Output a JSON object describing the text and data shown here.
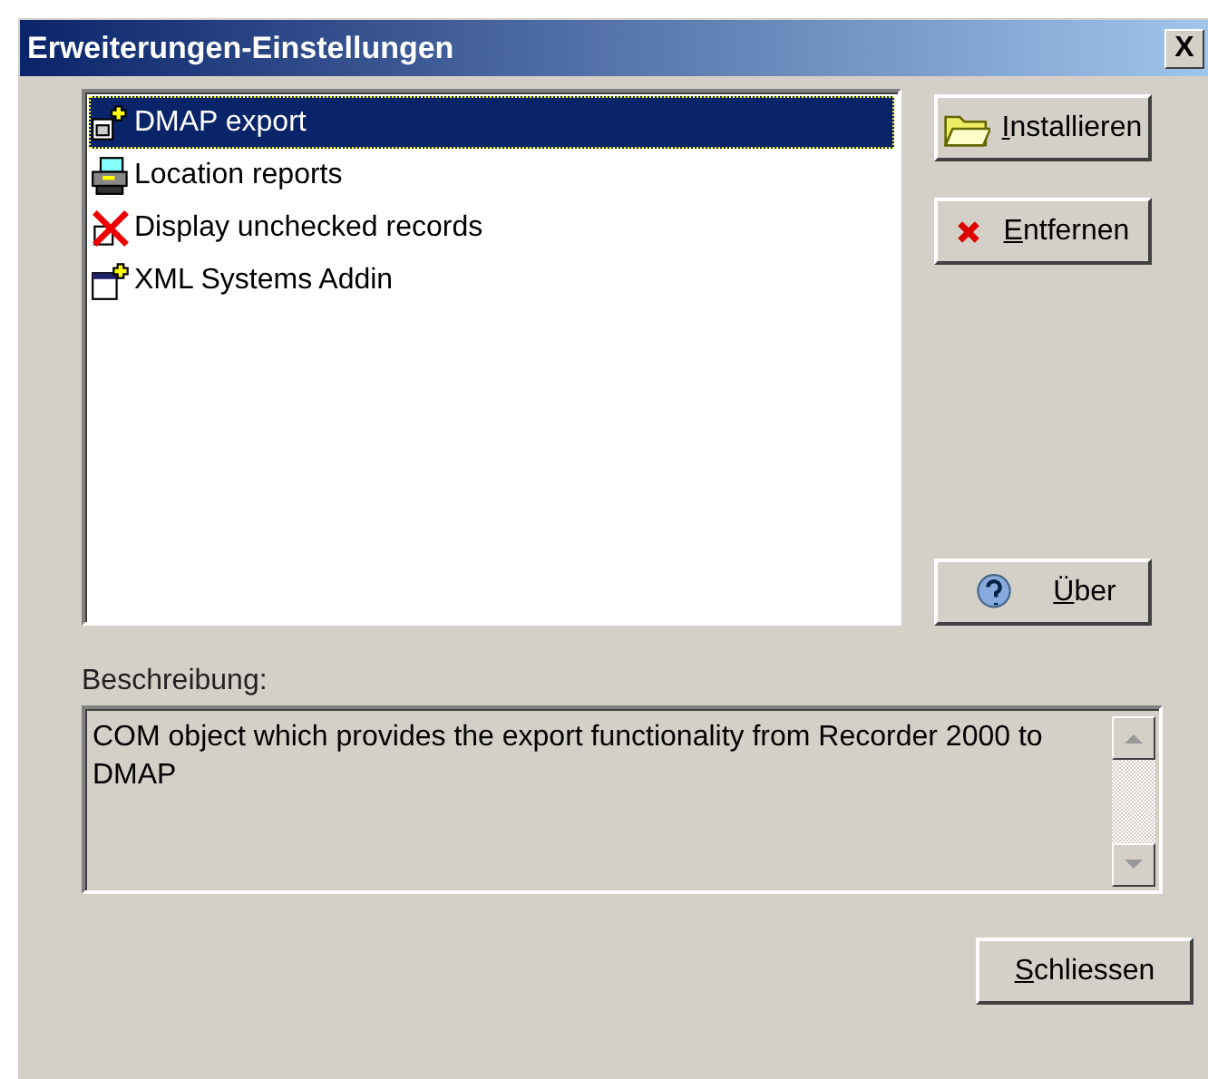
{
  "window": {
    "title": "Erweiterungen-Einstellungen",
    "close": "X"
  },
  "addins": [
    {
      "label": "DMAP export",
      "selected": true
    },
    {
      "label": "Location reports",
      "selected": false
    },
    {
      "label": "Display unchecked records",
      "selected": false
    },
    {
      "label": "XML Systems Addin",
      "selected": false
    }
  ],
  "buttons": {
    "install": "Installieren",
    "remove": "Entfernen",
    "about": "Über",
    "close": "Schliessen"
  },
  "description": {
    "label": "Beschreibung:",
    "text": "COM object which provides the export functionality from Recorder 2000 to DMAP"
  }
}
